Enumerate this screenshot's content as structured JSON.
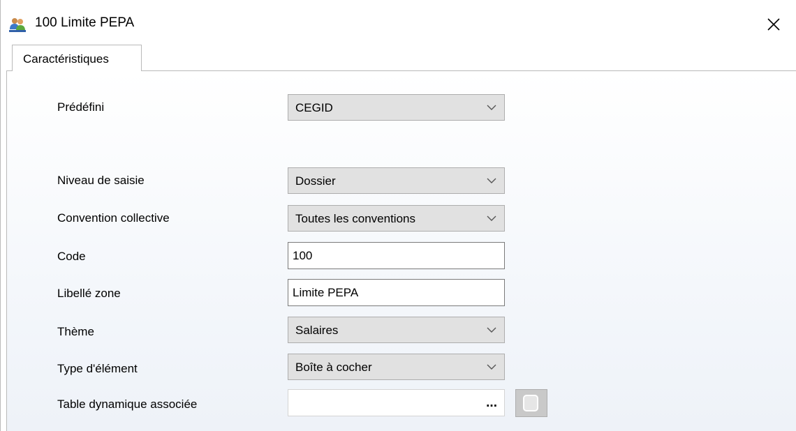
{
  "window": {
    "title": "100 Limite PEPA",
    "app_icon": "users-icon",
    "close_icon": "close-icon"
  },
  "tabs": [
    {
      "label": "Caractéristiques",
      "active": true
    }
  ],
  "form": {
    "predefini": {
      "label": "Prédéfini",
      "value": "CEGID"
    },
    "niveau_saisie": {
      "label": "Niveau de saisie",
      "value": "Dossier"
    },
    "convention": {
      "label": "Convention collective",
      "value": "Toutes les conventions"
    },
    "code": {
      "label": "Code",
      "value": "100"
    },
    "libelle": {
      "label": "Libellé zone",
      "value": "Limite PEPA"
    },
    "theme": {
      "label": "Thème",
      "value": "Salaires"
    },
    "type_element": {
      "label": "Type d'élément",
      "value": "Boîte à cocher"
    },
    "table_dynamique": {
      "label": "Table dynamique associée",
      "value": "",
      "button_label": "..."
    }
  },
  "colors": {
    "combo_bg": "#e1e1e1",
    "panel_bg": "#f4f7fb",
    "border": "#b9b9b9"
  }
}
